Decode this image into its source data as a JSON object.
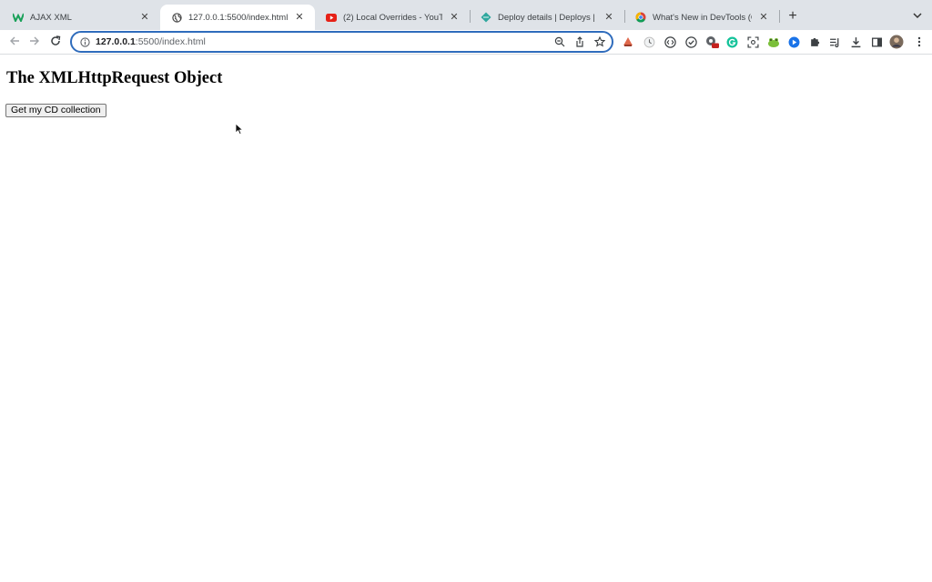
{
  "tabs": [
    {
      "title": "AJAX XML",
      "icon": "w-logo-icon",
      "active": false
    },
    {
      "title": "127.0.0.1:5500/index.html",
      "icon": "globe-icon",
      "active": true
    },
    {
      "title": "(2) Local Overrides - YouTube",
      "icon": "youtube-icon",
      "active": false
    },
    {
      "title": "Deploy details | Deploys | rand",
      "icon": "netlify-icon",
      "active": false
    },
    {
      "title": "What's New in DevTools (Chro",
      "icon": "chrome-icon",
      "active": false
    }
  ],
  "address_bar": {
    "host": "127.0.0.1",
    "rest": ":5500/index.html"
  },
  "page": {
    "heading": "The XMLHttpRequest Object",
    "button_label": "Get my CD collection"
  },
  "colors": {
    "tabstrip_bg": "#dfe3e8",
    "omnibox_border": "#2f6cbc"
  }
}
